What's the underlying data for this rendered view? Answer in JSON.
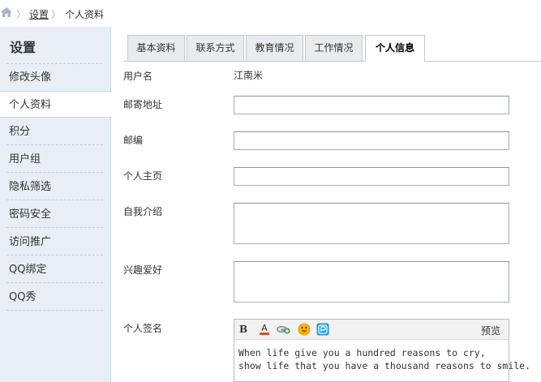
{
  "breadcrumb": {
    "home_icon": "home-icon",
    "sep": "〉",
    "items": [
      "设置",
      "个人资料"
    ]
  },
  "sidebar": {
    "title": "设置",
    "items": [
      {
        "label": "修改头像"
      },
      {
        "label": "个人资料"
      },
      {
        "label": "积分"
      },
      {
        "label": "用户组"
      },
      {
        "label": "隐私筛选"
      },
      {
        "label": "密码安全"
      },
      {
        "label": "访问推广"
      },
      {
        "label": "QQ绑定"
      },
      {
        "label": "QQ秀"
      }
    ],
    "active_index": 1
  },
  "tabs": [
    {
      "label": "基本资料"
    },
    {
      "label": "联系方式"
    },
    {
      "label": "教育情况"
    },
    {
      "label": "工作情况"
    },
    {
      "label": "个人信息"
    }
  ],
  "active_tab": 4,
  "form": {
    "username_label": "用户名",
    "username_value": "江南米",
    "address_label": "邮寄地址",
    "address_value": "",
    "zip_label": "邮编",
    "zip_value": "",
    "homepage_label": "个人主页",
    "homepage_value": "",
    "bio_label": "自我介绍",
    "bio_value": "",
    "hobby_label": "兴趣爱好",
    "hobby_value": "",
    "signature_label": "个人签名",
    "signature_toolbar": {
      "bold": "B",
      "color": "A",
      "preview": "预览",
      "icons": [
        "bold-icon",
        "font-color-icon",
        "link-icon",
        "emoji-icon",
        "app-icon"
      ]
    },
    "signature_lines": [
      "When life give you a hundred reasons to cry,",
      "show life that you have a thousand reasons to smile."
    ]
  },
  "colors": {
    "sidebar_bg": "#e8eef6",
    "tab_bg": "#e9ecef",
    "border": "#c4c9d0",
    "color_bar": "#e0482a",
    "emoji": "#f5b800",
    "app_icon": "#1e9bd7"
  }
}
